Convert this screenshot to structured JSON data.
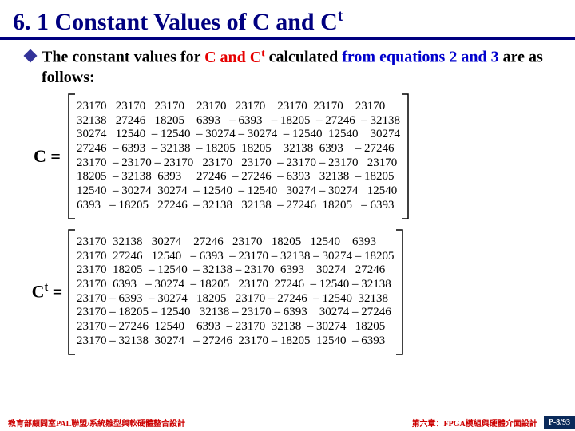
{
  "title_plain": "6. 1 Constant Values of C and C",
  "title_super": "t",
  "bullet": {
    "p1": "The constant values for ",
    "p2": "C and C",
    "p2sup": "t",
    "p3": " calculated ",
    "p4": "from equations 2 and 3",
    "p5": " are as follows:"
  },
  "labels": {
    "c": "C =",
    "ct_base": "C",
    "ct_sup": "t",
    "ct_eq": " ="
  },
  "matrix_c_text": "23170   23170   23170    23170   23170    23170  23170    23170\n32138   27246   18205    6393   – 6393   – 18205  – 27246  – 32138\n30274   12540  – 12540  – 30274 – 30274  – 12540  12540    30274\n27246  – 6393  – 32138  – 18205  18205    32138  6393    – 27246\n23170  – 23170 – 23170   23170   23170  – 23170 – 23170   23170\n18205  – 32138  6393     27246  – 27246  – 6393   32138  – 18205\n12540  – 30274  30274  – 12540  – 12540   30274 – 30274   12540\n6393   – 18205   27246  – 32138   32138  – 27246  18205   – 6393",
  "matrix_ct_text": "23170  32138   30274    27246   23170   18205   12540    6393\n23170  27246   12540   – 6393  – 23170 – 32138 – 30274 – 18205\n23170  18205  – 12540  – 32138 – 23170  6393    30274   27246\n23170  6393   – 30274  – 18205   23170  27246  – 12540 – 32138\n23170 – 6393  – 30274   18205   23170 – 27246  – 12540  32138\n23170 – 18205 – 12540   32138 – 23170 – 6393    30274 – 27246\n23170 – 27246  12540    6393  – 23170  32138  – 30274   18205\n23170 – 32138  30274   – 27246  23170 – 18205  12540  – 6393",
  "footer": {
    "left": "教育部顧問室PAL聯盟/系統雛型與軟硬體整合設計",
    "right": "第六章：FPGA模組與硬體介面設計",
    "pager": "P-8/93"
  }
}
